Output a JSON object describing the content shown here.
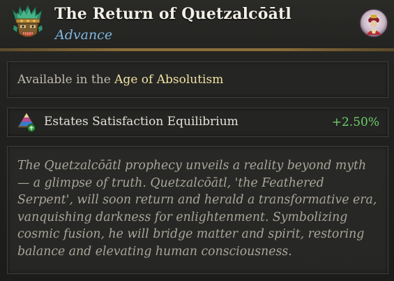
{
  "header": {
    "title": "The Return of Quetzalcōātl",
    "subtitle": "Advance",
    "icon": "aztec-mask-icon",
    "advisor_icon": "advisor-portrait-icon"
  },
  "availability": {
    "prefix": "Available in the ",
    "age": "Age of Absolutism"
  },
  "effect": {
    "icon": "estates-pyramid-icon",
    "label": "Estates Satisfaction Equilibrium",
    "value": "+2.50%"
  },
  "description": "The Quetzalcōātl prophecy unveils a reality beyond myth — a glimpse of truth. Quetzalcōātl, 'the Feathered Serpent', will soon return and herald a transformative era, vanquishing darkness for enlightenment. Symbolizing cosmic fusion, he will bridge matter and spirit, restoring balance and elevating human consciousness.",
  "colors": {
    "title": "#f2efe6",
    "subtitle": "#7fb8e2",
    "age_highlight": "#f1e2a4",
    "positive_value": "#6fce6a",
    "description": "#a9a599",
    "divider_gold": "#8a6e3c"
  }
}
